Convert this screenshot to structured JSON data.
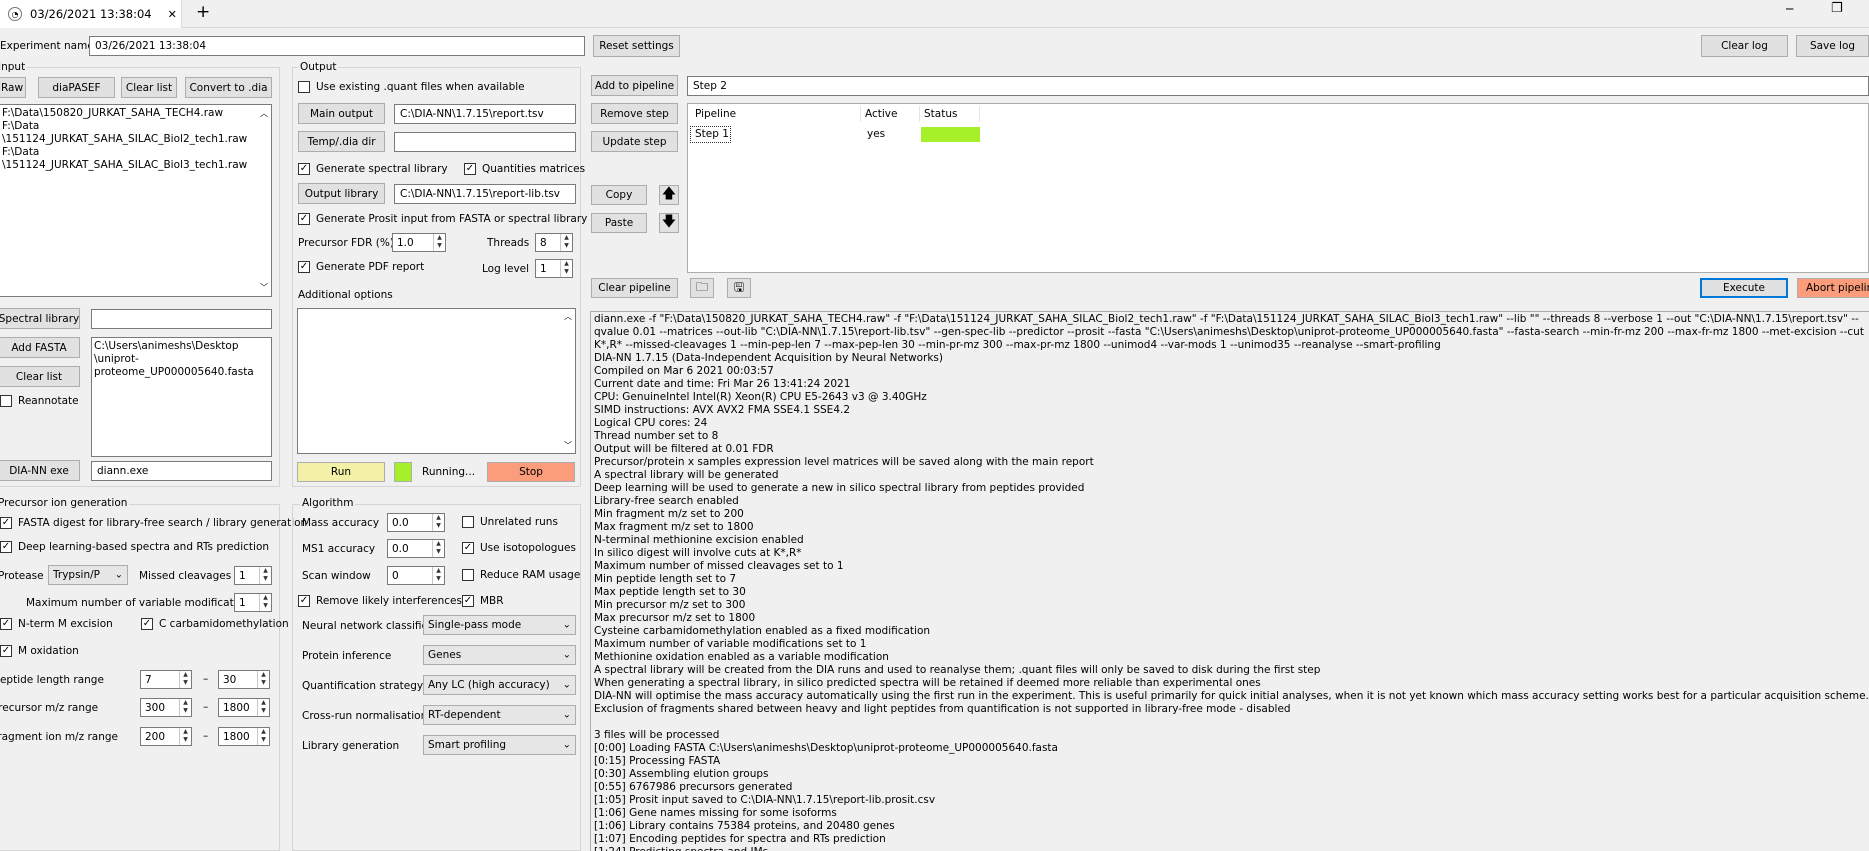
{
  "tab": {
    "title": "03/26/2021 13:38:04",
    "close": "✕",
    "new": "+"
  },
  "window": {
    "minimize": "─",
    "maximize": "❐"
  },
  "header": {
    "experiment_label": "Experiment name:",
    "experiment_value": "03/26/2021 13:38:04",
    "reset": "Reset settings",
    "clear_log": "Clear log",
    "save_log": "Save log"
  },
  "input": {
    "title": "Input",
    "raw": "Raw",
    "diapasef": "diaPASEF",
    "clear_list": "Clear list",
    "convert": "Convert to .dia",
    "files": [
      "F:\\Data\\150820_JURKAT_SAHA_TECH4.raw",
      "F:\\Data",
      "\\151124_JURKAT_SAHA_SILAC_Biol2_tech1.raw",
      "F:\\Data",
      "\\151124_JURKAT_SAHA_SILAC_Biol3_tech1.raw"
    ],
    "spectral_library": "Spectral library",
    "spectral_library_value": "",
    "add_fasta": "Add FASTA",
    "clear_list2": "Clear list",
    "fasta_lines": [
      "C:\\Users\\animeshs\\Desktop",
      "\\uniprot-",
      "proteome_UP000005640.fasta"
    ],
    "reannotate": "Reannotate",
    "diann_exe": "DIA-NN exe",
    "diann_exe_value": "diann.exe"
  },
  "output": {
    "title": "Output",
    "use_existing": "Use existing .quant files when available",
    "main_output": "Main output",
    "main_output_value": "C:\\DIA-NN\\1.7.15\\report.tsv",
    "temp_dir": "Temp/.dia dir",
    "temp_dir_value": "",
    "gen_spec_lib": "Generate spectral library",
    "quant_matrices": "Quantities matrices",
    "output_library": "Output library",
    "output_library_value": "C:\\DIA-NN\\1.7.15\\report-lib.tsv",
    "gen_prosit": "Generate Prosit input from FASTA or spectral library",
    "precursor_fdr": "Precursor FDR (%)",
    "precursor_fdr_value": "1.0",
    "threads": "Threads",
    "threads_value": "8",
    "gen_pdf": "Generate PDF report",
    "log_level": "Log level",
    "log_level_value": "1",
    "additional_options": "Additional options",
    "run": "Run",
    "running": "Running...",
    "stop": "Stop",
    "run_color": "#f3f0a8",
    "running_color": "#a6f02a",
    "stop_color": "#fb9c7a"
  },
  "precursor": {
    "title": "Precursor ion generation",
    "fasta_digest": "FASTA digest for library-free search / library generation",
    "deep_learning": "Deep learning-based spectra and RTs prediction",
    "protease": "Protease",
    "protease_value": "Trypsin/P",
    "missed_cleavages": "Missed cleavages",
    "missed_cleavages_value": "1",
    "max_var_mods": "Maximum number of variable modifications",
    "max_var_mods_value": "1",
    "nterm": "N-term M excision",
    "carbamido": "C carbamidomethylation",
    "m_ox": "M oxidation",
    "pep_len": "Peptide length range",
    "pep_len_min": "7",
    "pep_len_max": "30",
    "prec_mz": "Precursor m/z range",
    "prec_mz_min": "300",
    "prec_mz_max": "1800",
    "frag_mz": "Fragment ion m/z range",
    "frag_mz_min": "200",
    "frag_mz_max": "1800",
    "dash": "–"
  },
  "algorithm": {
    "title": "Algorithm",
    "mass_acc": "Mass accuracy",
    "mass_acc_value": "0.0",
    "ms1_acc": "MS1 accuracy",
    "ms1_acc_value": "0.0",
    "scan_window": "Scan window",
    "scan_window_value": "0",
    "unrelated": "Unrelated runs",
    "isotopologues": "Use isotopologues",
    "reduce_ram": "Reduce RAM usage",
    "remove_interf": "Remove likely interferences",
    "mbr": "MBR",
    "nn_classifier": "Neural network classifier",
    "nn_classifier_value": "Single-pass mode",
    "protein_inference": "Protein inference",
    "protein_inference_value": "Genes",
    "quant_strategy": "Quantification strategy",
    "quant_strategy_value": "Any LC (high accuracy)",
    "cross_run": "Cross-run normalisation",
    "cross_run_value": "RT-dependent",
    "lib_gen": "Library generation",
    "lib_gen_value": "Smart profiling"
  },
  "pipeline": {
    "add": "Add to pipeline",
    "step_name": "Step 2",
    "remove": "Remove step",
    "update": "Update step",
    "copy": "Copy",
    "paste": "Paste",
    "columns": [
      "Pipeline",
      "Active",
      "Status"
    ],
    "rows": [
      {
        "name": "Step 1",
        "active": "yes",
        "status_color": "#a6f02a"
      }
    ],
    "clear": "Clear pipeline",
    "execute": "Execute",
    "abort": "Abort pipeline"
  },
  "log": {
    "command": "diann.exe -f \"F:\\Data\\150820_JURKAT_SAHA_TECH4.raw\" -f \"F:\\Data\\151124_JURKAT_SAHA_SILAC_Biol2_tech1.raw\" -f \"F:\\Data\\151124_JURKAT_SAHA_SILAC_Biol3_tech1.raw\" --lib \"\" --threads 8 --verbose 1 --out \"C:\\DIA-NN\\1.7.15\\report.tsv\" --qvalue 0.01 --matrices  --out-lib \"C:\\DIA-NN\\1.7.15\\report-lib.tsv\" --gen-spec-lib --predictor --prosit --fasta \"C:\\Users\\animeshs\\Desktop\\uniprot-proteome_UP000005640.fasta\" --fasta-search --min-fr-mz 200 --max-fr-mz 1800 --met-excision --cut K*,R* --missed-cleavages 1 --min-pep-len 7 --max-pep-len 30 --min-pr-mz 300 --max-pr-mz 1800 --unimod4 --var-mods 1 --unimod35 --reanalyse --smart-profiling",
    "lines": [
      "DIA-NN 1.7.15 (Data-Independent Acquisition by Neural Networks)",
      "Compiled on Mar  6 2021 00:03:57",
      "Current date and time: Fri Mar 26 13:41:24 2021",
      "CPU: GenuineIntel Intel(R) Xeon(R) CPU E5-2643 v3 @ 3.40GHz",
      "SIMD instructions: AVX AVX2 FMA SSE4.1 SSE4.2",
      "Logical CPU cores: 24",
      "Thread number set to 8",
      "Output will be filtered at 0.01 FDR",
      "Precursor/protein x samples expression level matrices will be saved along with the main report",
      "A spectral library will be generated",
      "Deep learning will be used to generate a new in silico spectral library from peptides provided",
      "Library-free search enabled",
      "Min fragment m/z set to 200",
      "Max fragment m/z set to 1800",
      "N-terminal methionine excision enabled",
      "In silico digest will involve cuts at K*,R*",
      "Maximum number of missed cleavages set to 1",
      "Min peptide length set to 7",
      "Max peptide length set to 30",
      "Min precursor m/z set to 300",
      "Max precursor m/z set to 1800",
      "Cysteine carbamidomethylation enabled as a fixed modification",
      "Maximum number of variable modifications set to 1",
      "Methionine oxidation enabled as a variable modification",
      "A spectral library will be created from the DIA runs and used to reanalyse them; .quant files will only be saved to disk during the first step",
      "When generating a spectral library, in silico predicted spectra will be retained if deemed more reliable than experimental ones",
      "DIA-NN will optimise the mass accuracy automatically using the first run in the experiment. This is useful primarily for quick initial analyses, when it is not yet known which mass accuracy setting works best for a particular acquisition scheme.",
      "Exclusion of fragments shared between heavy and light peptides from quantification is not supported in library-free mode - disabled",
      "",
      "3 files will be processed",
      "[0:00] Loading FASTA C:\\Users\\animeshs\\Desktop\\uniprot-proteome_UP000005640.fasta",
      "[0:15] Processing FASTA",
      "[0:30] Assembling elution groups",
      "[0:55] 6767986 precursors generated",
      "[1:05] Prosit input saved to C:\\DIA-NN\\1.7.15\\report-lib.prosit.csv",
      "[1:06] Gene names missing for some isoforms",
      "[1:06] Library contains 75384 proteins, and 20480 genes",
      "[1:07] Encoding peptides for spectra and RTs prediction",
      "[1:24] Predicting spectra and IMs"
    ]
  }
}
